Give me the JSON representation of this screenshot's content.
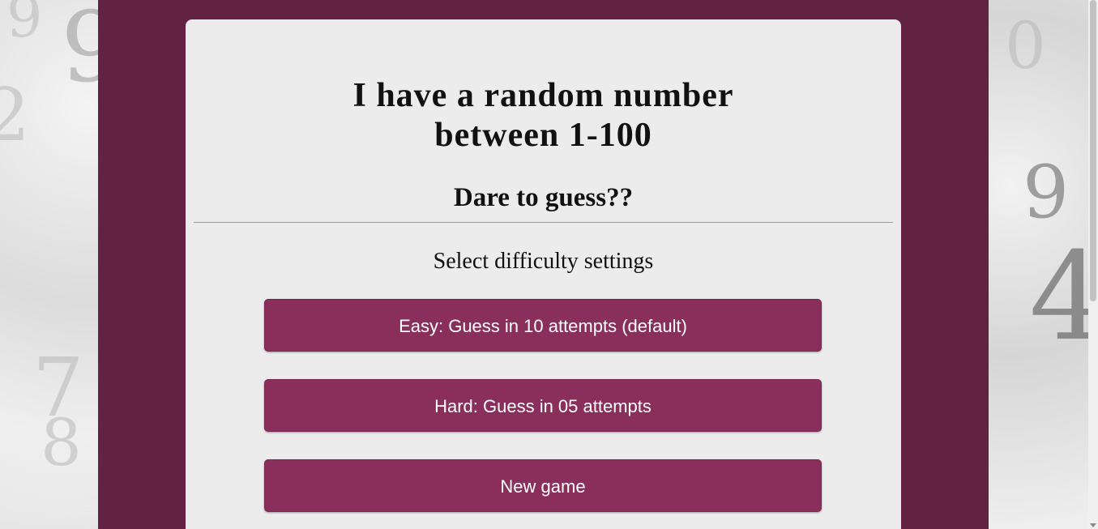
{
  "heading": {
    "line1": "I have a random number",
    "line2": "between 1-100"
  },
  "subheading": "Dare to guess??",
  "settings_label": "Select difficulty settings",
  "buttons": {
    "easy": "Easy: Guess in 10 attempts (default)",
    "hard": "Hard: Guess in 05 attempts",
    "new_game": "New game"
  },
  "colors": {
    "frame": "#622343",
    "card": "#ececec",
    "button": "#8a2e5b",
    "button_text": "#ffffff"
  },
  "icons": {
    "scroll_down": "scroll-down-arrow-icon"
  }
}
